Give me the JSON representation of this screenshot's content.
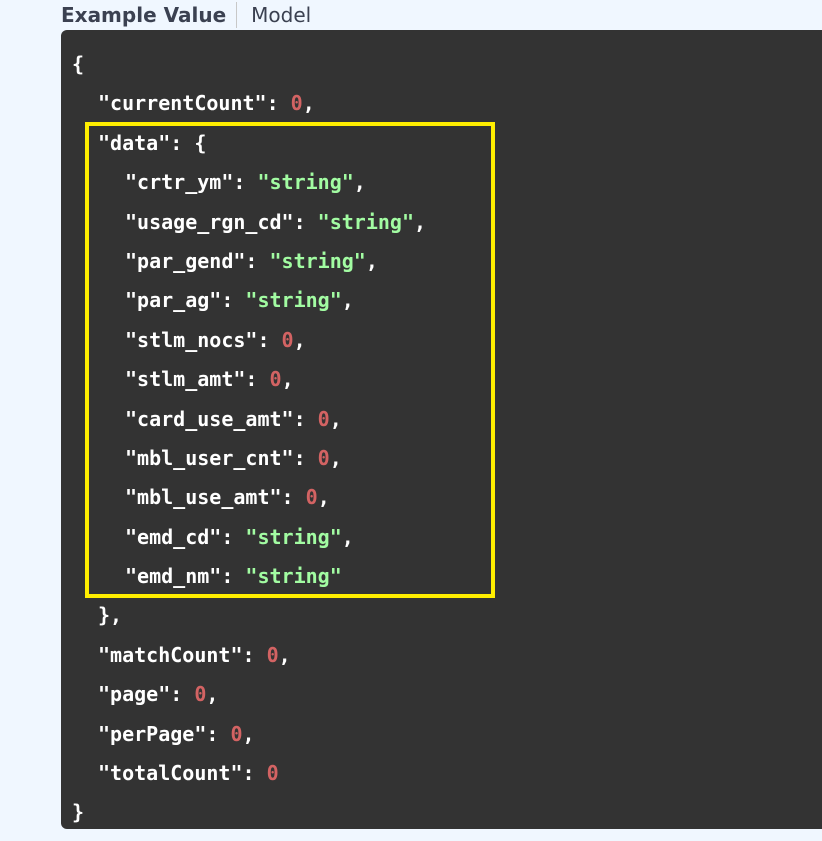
{
  "tabs": {
    "example_value": "Example Value",
    "model": "Model"
  },
  "json": {
    "open_brace": "{",
    "close_brace": "}",
    "current_count": {
      "key": "\"currentCount\"",
      "value": "0"
    },
    "data_key": "\"data\"",
    "data_open": "{",
    "data_close": "},",
    "fields": [
      {
        "key": "\"crtr_ym\"",
        "value": "\"string\"",
        "type": "string",
        "comma": ","
      },
      {
        "key": "\"usage_rgn_cd\"",
        "value": "\"string\"",
        "type": "string",
        "comma": ","
      },
      {
        "key": "\"par_gend\"",
        "value": "\"string\"",
        "type": "string",
        "comma": ","
      },
      {
        "key": "\"par_ag\"",
        "value": "\"string\"",
        "type": "string",
        "comma": ","
      },
      {
        "key": "\"stlm_nocs\"",
        "value": "0",
        "type": "number",
        "comma": ","
      },
      {
        "key": "\"stlm_amt\"",
        "value": "0",
        "type": "number",
        "comma": ","
      },
      {
        "key": "\"card_use_amt\"",
        "value": "0",
        "type": "number",
        "comma": ","
      },
      {
        "key": "\"mbl_user_cnt\"",
        "value": "0",
        "type": "number",
        "comma": ","
      },
      {
        "key": "\"mbl_use_amt\"",
        "value": "0",
        "type": "number",
        "comma": ","
      },
      {
        "key": "\"emd_cd\"",
        "value": "\"string\"",
        "type": "string",
        "comma": ","
      },
      {
        "key": "\"emd_nm\"",
        "value": "\"string\"",
        "type": "string",
        "comma": ""
      }
    ],
    "match_count": {
      "key": "\"matchCount\"",
      "value": "0"
    },
    "page": {
      "key": "\"page\"",
      "value": "0"
    },
    "per_page": {
      "key": "\"perPage\"",
      "value": "0"
    },
    "total_count": {
      "key": "\"totalCount\"",
      "value": "0"
    }
  },
  "colors": {
    "background": "#333333",
    "string_value": "#a2fca2",
    "number_value": "#d36363",
    "highlight": "#ffee00"
  }
}
